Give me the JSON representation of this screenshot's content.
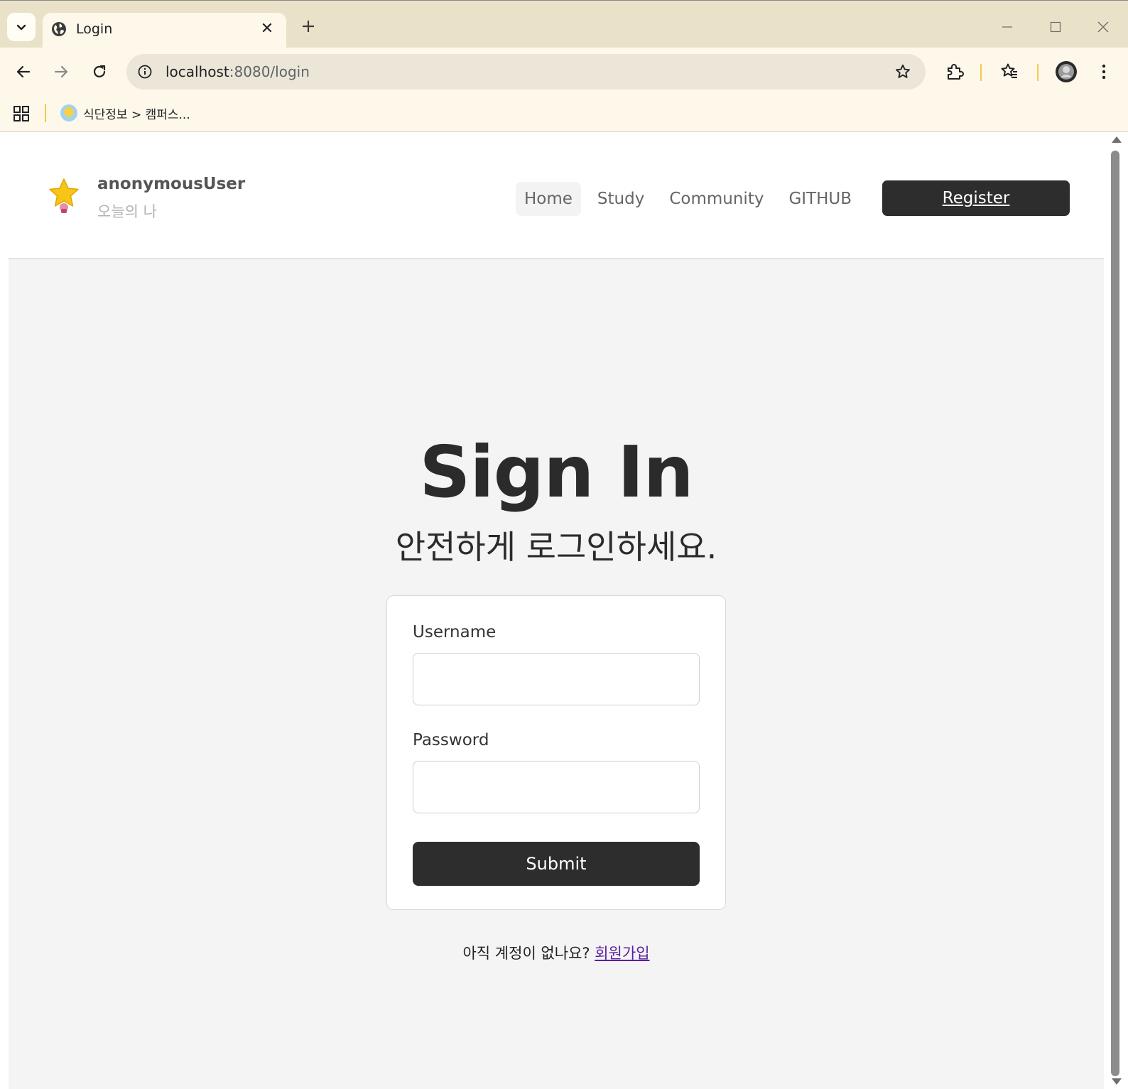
{
  "browser": {
    "tab": {
      "title": "Login"
    },
    "url": {
      "host": "localhost",
      "rest": ":8080/login"
    },
    "bookmarks": [
      {
        "label": "식단정보 > 캠퍼스..."
      }
    ]
  },
  "header": {
    "brand_name": "anonymousUser",
    "brand_sub": "오늘의 나",
    "nav": [
      {
        "label": "Home",
        "active": true
      },
      {
        "label": "Study",
        "active": false
      },
      {
        "label": "Community",
        "active": false
      },
      {
        "label": "GITHUB",
        "active": false
      }
    ],
    "register_label": "Register"
  },
  "main": {
    "title": "Sign In",
    "subtitle": "안전하게 로그인하세요.",
    "form": {
      "username_label": "Username",
      "username_value": "",
      "password_label": "Password",
      "password_value": "",
      "submit_label": "Submit"
    },
    "signup_prompt": "아직 계정이 없나요?",
    "signup_link": "회원가입"
  },
  "colors": {
    "chrome_titlebar": "#e9e2c8",
    "chrome_toolbar": "#fdf8ea",
    "page_bg": "#f4f4f4",
    "button_dark": "#2d2d2d",
    "link_visited": "#5a1ea0"
  }
}
